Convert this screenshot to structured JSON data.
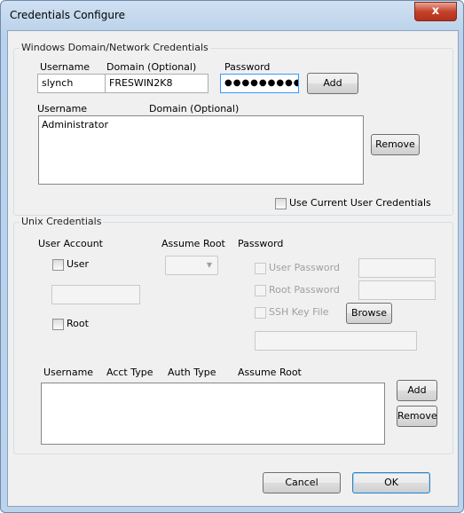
{
  "window": {
    "title": "Credentials Configure",
    "close_glyph": "x"
  },
  "windows_group": {
    "label": "Windows Domain/Network Credentials",
    "username_label": "Username",
    "domain_label": "Domain (Optional)",
    "password_label": "Password",
    "username_value": "slynch",
    "domain_value": "FRESWIN2K8",
    "password_value": "●●●●●●●●●",
    "add_button": "Add",
    "list_headers": [
      "Username",
      "Domain (Optional)"
    ],
    "list_rows": [
      {
        "username": "Administrator",
        "domain": ""
      }
    ],
    "remove_button": "Remove",
    "use_current_label": "Use Current User Credentials"
  },
  "unix_group": {
    "label": "Unix Credentials",
    "user_account_label": "User Account",
    "assume_root_label": "Assume Root",
    "password_label": "Password",
    "user_checkbox_label": "User",
    "root_checkbox_label": "Root",
    "user_password_label": "User Password",
    "root_password_label": "Root Password",
    "ssh_key_label": "SSH Key File",
    "browse_button": "Browse",
    "list_headers": [
      "Username",
      "Acct Type",
      "Auth Type",
      "Assume Root"
    ],
    "add_button": "Add",
    "remove_button": "Remove"
  },
  "footer": {
    "cancel_button": "Cancel",
    "ok_button": "OK"
  }
}
